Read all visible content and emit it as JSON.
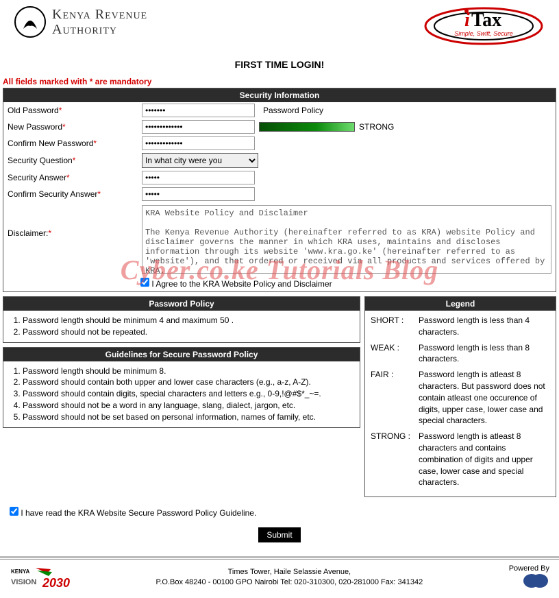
{
  "header": {
    "org_line1": "Kenya Revenue",
    "org_line2": "Authority",
    "itax_tagline": "Simple, Swift, Secure"
  },
  "page_title": "FIRST TIME LOGIN!",
  "mandatory_note": "All fields marked with * are mandatory",
  "security_section_title": "Security Information",
  "fields": {
    "old_password": {
      "label": "Old Password",
      "value": "•••••••"
    },
    "new_password": {
      "label": "New Password",
      "value": "•••••••••••••"
    },
    "confirm_new_password": {
      "label": "Confirm New Password",
      "value": "•••••••••••••"
    },
    "security_question": {
      "label": "Security Question",
      "selected": "In what city were you"
    },
    "security_answer": {
      "label": "Security Answer",
      "value": "•••••"
    },
    "confirm_security_answer": {
      "label": "Confirm Security Answer",
      "value": "•••••"
    },
    "password_policy_label": "Password Policy",
    "strength_label": "STRONG",
    "disclaimer_label": "Disclaimer:",
    "disclaimer_text": "KRA Website Policy and Disclaimer\n\nThe Kenya Revenue Authority (hereinafter referred to as KRA) website Policy and disclaimer governs the manner in which KRA uses, maintains and discloses information through its website 'www.kra.go.ke' (hereinafter referred to as 'website'), and that ordered or received via all products and services offered by KRA.",
    "agree_disclaimer": "I Agree to the KRA Website Policy and Disclaimer"
  },
  "password_policy_box": {
    "title": "Password Policy",
    "item1": "Password length should be minimum 4 and maximum  50 .",
    "item2": "Password should not be repeated."
  },
  "guidelines_box": {
    "title": "Guidelines for Secure Password Policy",
    "item1": "Password length should be minimum 8.",
    "item2": "Password should contain both upper and lower case characters (e.g., a-z, A-Z).",
    "item3": "Password should contain digits, special characters and letters e.g., 0-9,!@#$*_~=.",
    "item4": "Password should not be a word in any language, slang, dialect, jargon, etc.",
    "item5": "Password should not be set based on personal information, names of family, etc."
  },
  "legend_box": {
    "title": "Legend",
    "short_key": "SHORT :",
    "short_val": "Password length is less than 4 characters.",
    "weak_key": "WEAK :",
    "weak_val": "Password length is less than 8 characters.",
    "fair_key": "FAIR :",
    "fair_val": "Password length is atleast 8 characters. But password does not contain atleast one occurence of digits, upper case, lower case and special characters.",
    "strong_key": "STRONG :",
    "strong_val": "Password length is atleast 8 characters and contains combination of digits and upper case, lower case and special characters."
  },
  "guideline_check_label": "I have read the KRA Website Secure Password Policy Guideline.",
  "submit_label": "Submit",
  "footer": {
    "line1": "Times Tower, Haile Selassie Avenue,",
    "line2": "P.O.Box 48240 - 00100 GPO Nairobi Tel: 020-310300, 020-281000 Fax: 341342",
    "powered_by": "Powered By",
    "vision_text1": "KENYA",
    "vision_text2": "VISION",
    "vision_year": "2030"
  },
  "watermark": "Cyber.co.ke Tutorials Blog"
}
